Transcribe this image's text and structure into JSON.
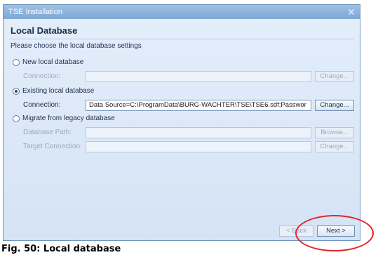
{
  "window": {
    "title": "TSE Installation",
    "close_glyph": "✕"
  },
  "header": {
    "title": "Local Database",
    "subtitle": "Please choose the local database settings"
  },
  "options": {
    "new_local": {
      "label": "New local database",
      "connection_label": "Connection:",
      "connection_value": "",
      "button_label": "Change...",
      "checked": false
    },
    "existing_local": {
      "label": "Existing local database",
      "connection_label": "Connection:",
      "connection_value": "Data Source=C:\\ProgramData\\BURG-WACHTER\\TSE\\TSE6.sdf;Passwor",
      "button_label": "Change...",
      "checked": true
    },
    "migrate_legacy": {
      "label": "Migrate from legacy database",
      "path_label": "Database Path:",
      "path_value": "",
      "target_label": "Target Connection:",
      "target_value": "",
      "browse_label": "Browse...",
      "target_button_label": "Change...",
      "checked": false
    }
  },
  "footer": {
    "back_label": "< Back",
    "next_label": "Next >"
  },
  "caption": "Fig. 50: Local database",
  "colors": {
    "highlight_circle": "#e3262e",
    "titlebar": "#8fb5df"
  }
}
